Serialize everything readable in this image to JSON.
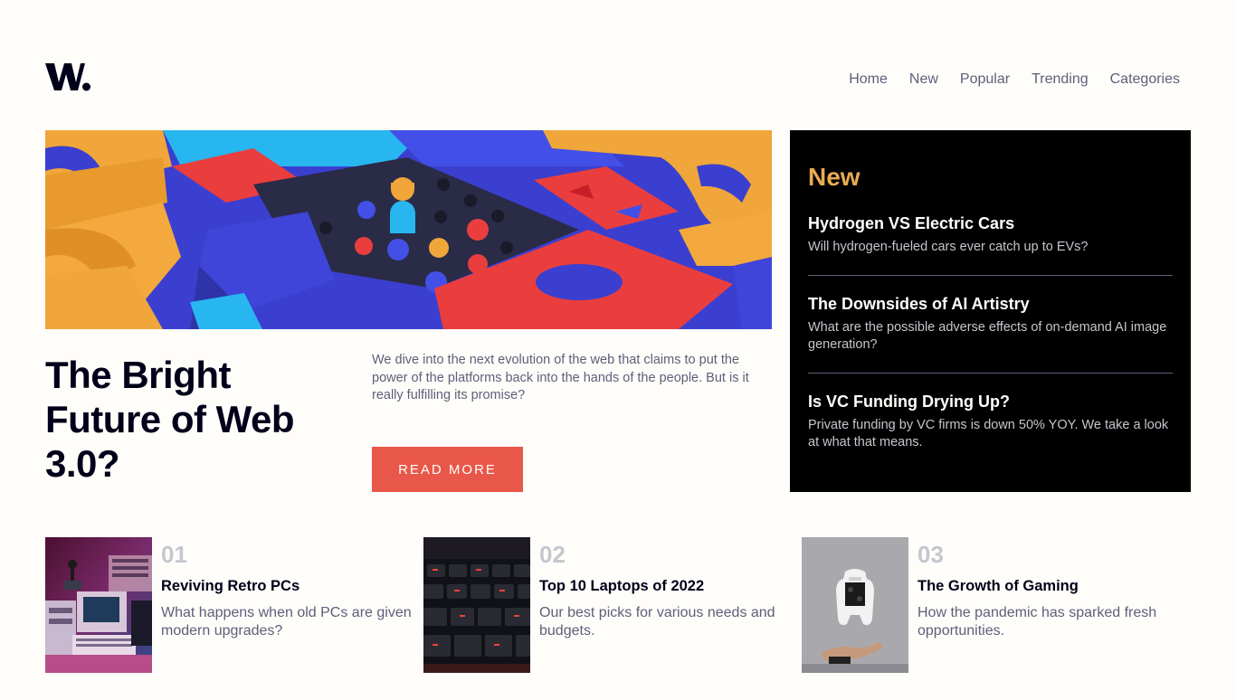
{
  "header": {
    "logo_text": "W.",
    "nav": [
      "Home",
      "New",
      "Popular",
      "Trending",
      "Categories"
    ]
  },
  "hero": {
    "title": "The Bright Future of Web 3.0?",
    "description": "We dive into the next evolution of the web that claims to put the power of the platforms back into the hands of the people. But is it really fulfilling its promise?",
    "button_label": "READ MORE"
  },
  "new_section": {
    "heading": "New",
    "items": [
      {
        "title": "Hydrogen VS Electric Cars",
        "desc": "Will hydrogen-fueled cars ever catch up to EVs?"
      },
      {
        "title": "The Downsides of AI Artistry",
        "desc": "What are the possible adverse effects of on-demand AI image generation?"
      },
      {
        "title": "Is VC Funding Drying Up?",
        "desc": "Private funding by VC firms is down 50% YOY. We take a look at what that means."
      }
    ]
  },
  "articles": [
    {
      "num": "01",
      "title": "Reviving Retro PCs",
      "desc": "What happens when old PCs are given modern upgrades?"
    },
    {
      "num": "02",
      "title": "Top 10 Laptops of 2022",
      "desc": "Our best picks for various needs and budgets."
    },
    {
      "num": "03",
      "title": "The Growth of Gaming",
      "desc": "How the pandemic has sparked fresh opportunities."
    }
  ],
  "colors": {
    "accent_red": "#e9574a",
    "accent_orange": "#e9ab53",
    "dark": "#00001a",
    "grey": "#5d5f79",
    "light_grey": "#c5c6ce",
    "background": "#fffdfa"
  },
  "icons": [
    "w-logo",
    "hero-illustration",
    "retro-pc-thumbnail",
    "laptop-keyboard-thumbnail",
    "gaming-controller-thumbnail"
  ]
}
